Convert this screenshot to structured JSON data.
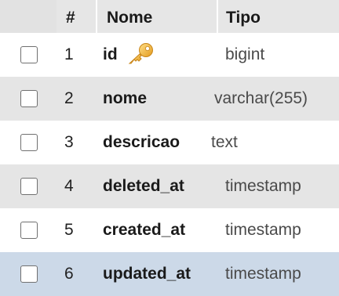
{
  "table": {
    "headers": {
      "checkbox": "",
      "number": "#",
      "name": "Nome",
      "type": "Tipo"
    },
    "rows": [
      {
        "number": "1",
        "name": "id",
        "type": "bigint",
        "primary_key": true,
        "icon": "key-icon",
        "checked": false
      },
      {
        "number": "2",
        "name": "nome",
        "type": "varchar(255)",
        "primary_key": false,
        "checked": false
      },
      {
        "number": "3",
        "name": "descricao",
        "type": "text",
        "primary_key": false,
        "checked": false
      },
      {
        "number": "4",
        "name": "deleted_at",
        "type": "timestamp",
        "primary_key": false,
        "checked": false
      },
      {
        "number": "5",
        "name": "created_at",
        "type": "timestamp",
        "primary_key": false,
        "checked": false
      },
      {
        "number": "6",
        "name": "updated_at",
        "type": "timestamp",
        "primary_key": false,
        "checked": false,
        "hovered": true
      }
    ]
  },
  "colors": {
    "header_bg": "#e6e6e6",
    "row_even_bg": "#e5e5e5",
    "row_hover_bg": "#ccd9e8",
    "key_icon": "#f2b233"
  }
}
